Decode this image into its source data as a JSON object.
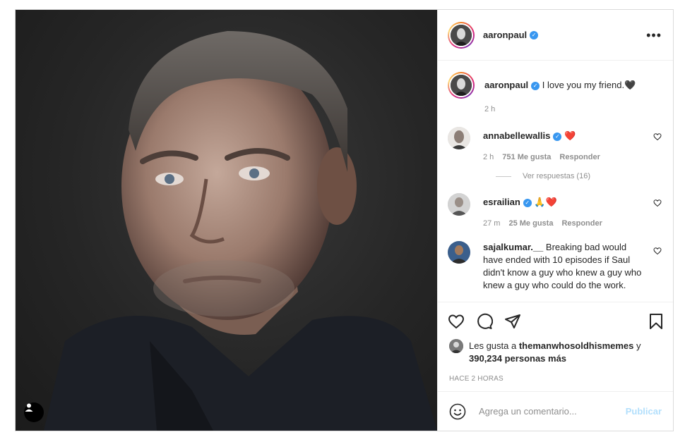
{
  "header": {
    "username": "aaronpaul"
  },
  "caption": {
    "username": "aaronpaul",
    "text": "I love you my friend.",
    "emoji": "🖤",
    "time": "2 h"
  },
  "comments": [
    {
      "username": "annabellewallis",
      "verified": true,
      "text": "❤️",
      "time": "2 h",
      "likes": "751 Me gusta",
      "reply": "Responder"
    },
    {
      "username": "esrailian",
      "verified": true,
      "text": "🙏❤️",
      "time": "27 m",
      "likes": "25 Me gusta",
      "reply": "Responder"
    },
    {
      "username": "sajalkumar.__",
      "verified": false,
      "text": "Breaking bad would have ended with 10 episodes if Saul didn't know a guy who knew a guy who knew a guy who could do the work."
    }
  ],
  "replies_link": "Ver respuestas (16)",
  "likes": {
    "prefix": "Les gusta a",
    "user": "themanwhosoldhismemes",
    "joiner": "y",
    "count": "390,234 personas más"
  },
  "timestamp": "Hace 2 horas",
  "add_comment": {
    "placeholder": "Agrega un comentario...",
    "publish": "Publicar"
  },
  "colors": {
    "verified": "#3897f0",
    "publish": "#b2dffc",
    "heart_red": "#ed4956"
  }
}
